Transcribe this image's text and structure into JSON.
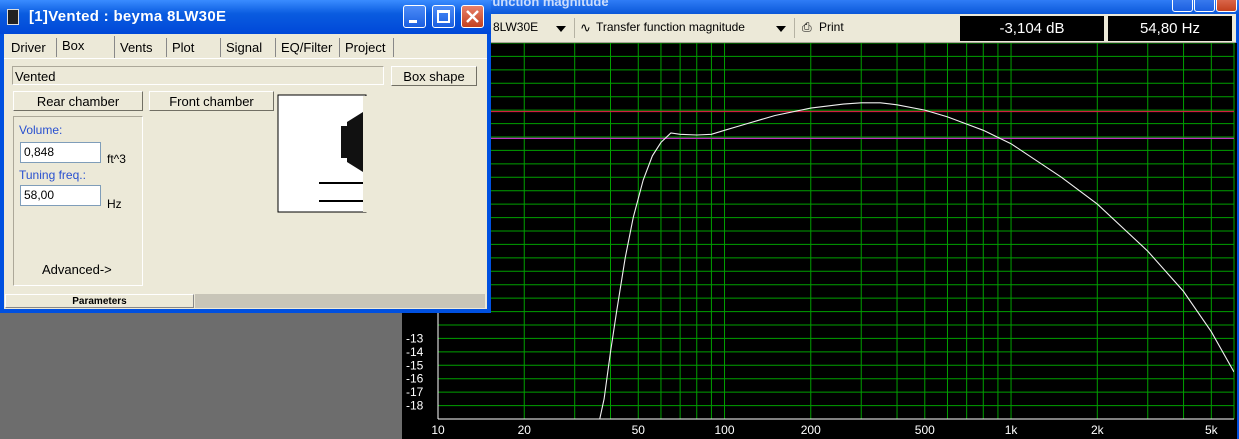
{
  "plot_window": {
    "title": "function magnitude",
    "toolbar": {
      "driver_select": "8LW30E",
      "view_select": "Transfer function magnitude",
      "print_label": "Print"
    },
    "readout_db": "-3,104 dB",
    "readout_hz": "54,80 Hz"
  },
  "dialog": {
    "title": "[1]Vented : beyma 8LW30E",
    "tabs": [
      {
        "label": "Driver"
      },
      {
        "label": "Box"
      },
      {
        "label": "Vents"
      },
      {
        "label": "Plot"
      },
      {
        "label": "Signal"
      },
      {
        "label": "EQ/Filter"
      },
      {
        "label": "Project"
      }
    ],
    "active_tab": "Box",
    "box_type": "Vented",
    "box_shape_label": "Box shape",
    "rear_chamber_label": "Rear chamber",
    "front_chamber_label": "Front chamber",
    "volume_label": "Volume:",
    "volume_value": "0,848",
    "volume_unit": "ft^3",
    "tuning_label": "Tuning freq.:",
    "tuning_value": "58,00",
    "tuning_unit": "Hz",
    "advanced_label": "Advanced->",
    "status_label": "Parameters"
  },
  "colors": {
    "plot_bg": "#000000",
    "grid": "#00a000",
    "curve": "#f0f0f0",
    "ref_line_red": "#d02040",
    "ref_line_magenta": "#c030c0"
  },
  "chart_data": {
    "type": "line",
    "x_scale": "log",
    "xlim": [
      10,
      6000
    ],
    "ylim": [
      -19,
      9
    ],
    "x_ticks": [
      10,
      20,
      50,
      100,
      200,
      500,
      1000,
      2000,
      5000
    ],
    "x_tick_labels": [
      "10",
      "20",
      "50",
      "100",
      "200",
      "500",
      "1k",
      "2k",
      "5k"
    ],
    "y_tick_labels": [
      {
        "value": -13,
        "label": "-13"
      },
      {
        "value": -14,
        "label": "-14"
      },
      {
        "value": -15,
        "label": "-15"
      },
      {
        "value": -16,
        "label": "-16"
      },
      {
        "value": -17,
        "label": "-17"
      },
      {
        "value": -18,
        "label": "-18"
      }
    ],
    "ref_lines": [
      {
        "y": 3.9,
        "color": "red"
      },
      {
        "y": 1.9,
        "color": "magenta"
      }
    ],
    "series": [
      {
        "points": [
          [
            35,
            -21
          ],
          [
            38,
            -17.5
          ],
          [
            40,
            -14
          ],
          [
            42,
            -11
          ],
          [
            45,
            -7
          ],
          [
            48,
            -4
          ],
          [
            52,
            -1.2
          ],
          [
            56,
            0.6
          ],
          [
            60,
            1.6
          ],
          [
            65,
            2.3
          ],
          [
            70,
            2.2
          ],
          [
            80,
            2.15
          ],
          [
            90,
            2.2
          ],
          [
            100,
            2.5
          ],
          [
            120,
            3.0
          ],
          [
            150,
            3.6
          ],
          [
            200,
            4.15
          ],
          [
            260,
            4.45
          ],
          [
            300,
            4.55
          ],
          [
            350,
            4.55
          ],
          [
            400,
            4.4
          ],
          [
            500,
            4.0
          ],
          [
            600,
            3.5
          ],
          [
            800,
            2.5
          ],
          [
            1000,
            1.5
          ],
          [
            1500,
            -1.0
          ],
          [
            2000,
            -3.0
          ],
          [
            3000,
            -6.5
          ],
          [
            4000,
            -9.5
          ],
          [
            5000,
            -12.5
          ],
          [
            6000,
            -15.5
          ]
        ]
      }
    ]
  }
}
